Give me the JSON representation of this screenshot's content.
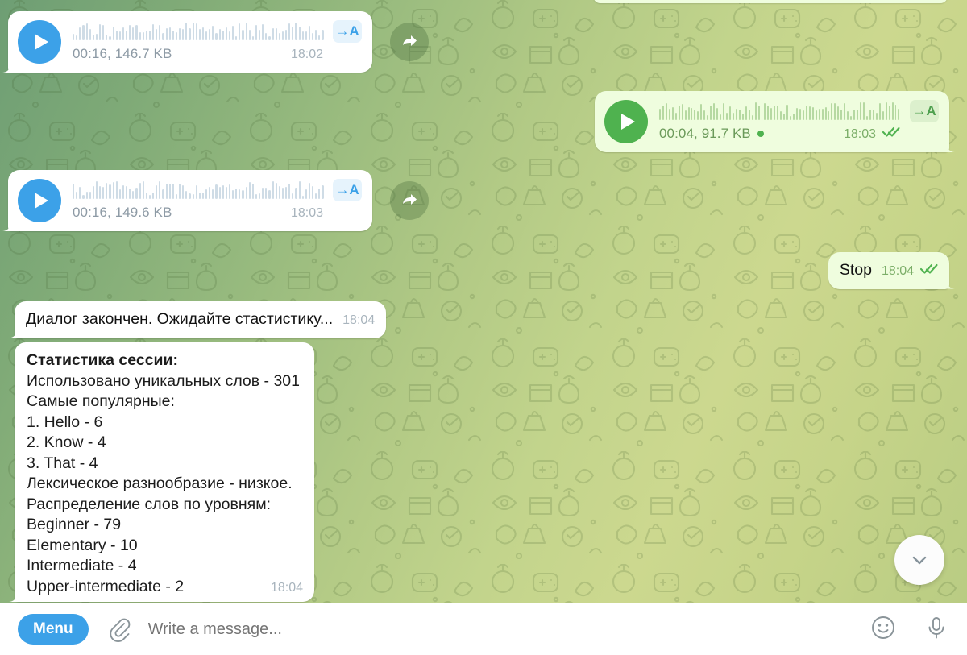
{
  "app": {
    "title": "Telegram Chat"
  },
  "messages": [
    {
      "id": "voice-in-1",
      "type": "voice",
      "direction": "incoming",
      "duration_size": "00:16, 146.7 KB",
      "time": "18:02",
      "transcribe_label": "→A",
      "has_forward_button": true
    },
    {
      "id": "voice-out-1",
      "type": "voice",
      "direction": "outgoing",
      "duration_size": "00:04, 91.7 KB",
      "time": "18:03",
      "transcribe_label": "→A",
      "unread_dot": true,
      "read_status": "read"
    },
    {
      "id": "voice-in-2",
      "type": "voice",
      "direction": "incoming",
      "duration_size": "00:16, 149.6 KB",
      "time": "18:03",
      "transcribe_label": "→A",
      "has_forward_button": true
    },
    {
      "id": "text-out-stop",
      "type": "text",
      "direction": "outgoing",
      "text": "Stop",
      "time": "18:04",
      "read_status": "read"
    },
    {
      "id": "text-in-dialog-end",
      "type": "text",
      "direction": "incoming",
      "text": "Диалог закончен. Ожидайте стастистику...",
      "time": "18:04"
    },
    {
      "id": "text-in-stats",
      "type": "stats",
      "direction": "incoming",
      "time": "18:04",
      "lines": [
        {
          "text": "Статистика сессии:",
          "bold": true
        },
        {
          "text": "Использовано уникальных слов - 301",
          "bold": false
        },
        {
          "text": "Самые популярные:",
          "bold": false
        },
        {
          "text": "1. Hello - 6",
          "bold": false
        },
        {
          "text": "2. Know - 4",
          "bold": false
        },
        {
          "text": "3. That - 4",
          "bold": false
        },
        {
          "text": "Лексическое разнообразие - низкое.",
          "bold": false
        },
        {
          "text": "Распределение слов по уровням:",
          "bold": false
        },
        {
          "text": "Beginner - 79",
          "bold": false
        },
        {
          "text": "Elementary - 10",
          "bold": false
        },
        {
          "text": "Intermediate - 4",
          "bold": false
        },
        {
          "text": "Upper-intermediate - 2",
          "bold": false
        }
      ]
    }
  ],
  "composer": {
    "menu_label": "Menu",
    "placeholder": "Write a message...",
    "attach_icon": "paperclip-icon",
    "emoji_icon": "smiley-icon",
    "voice_icon": "microphone-icon"
  },
  "scroll_down": {
    "icon": "chevron-down-icon"
  },
  "colors": {
    "incoming_bubble": "#ffffff",
    "outgoing_bubble": "#effdde",
    "play_blue": "#3ca1e8",
    "play_green": "#4fb24f",
    "accent_blue": "#3ca1e8",
    "tick_green": "#4fb24f"
  }
}
